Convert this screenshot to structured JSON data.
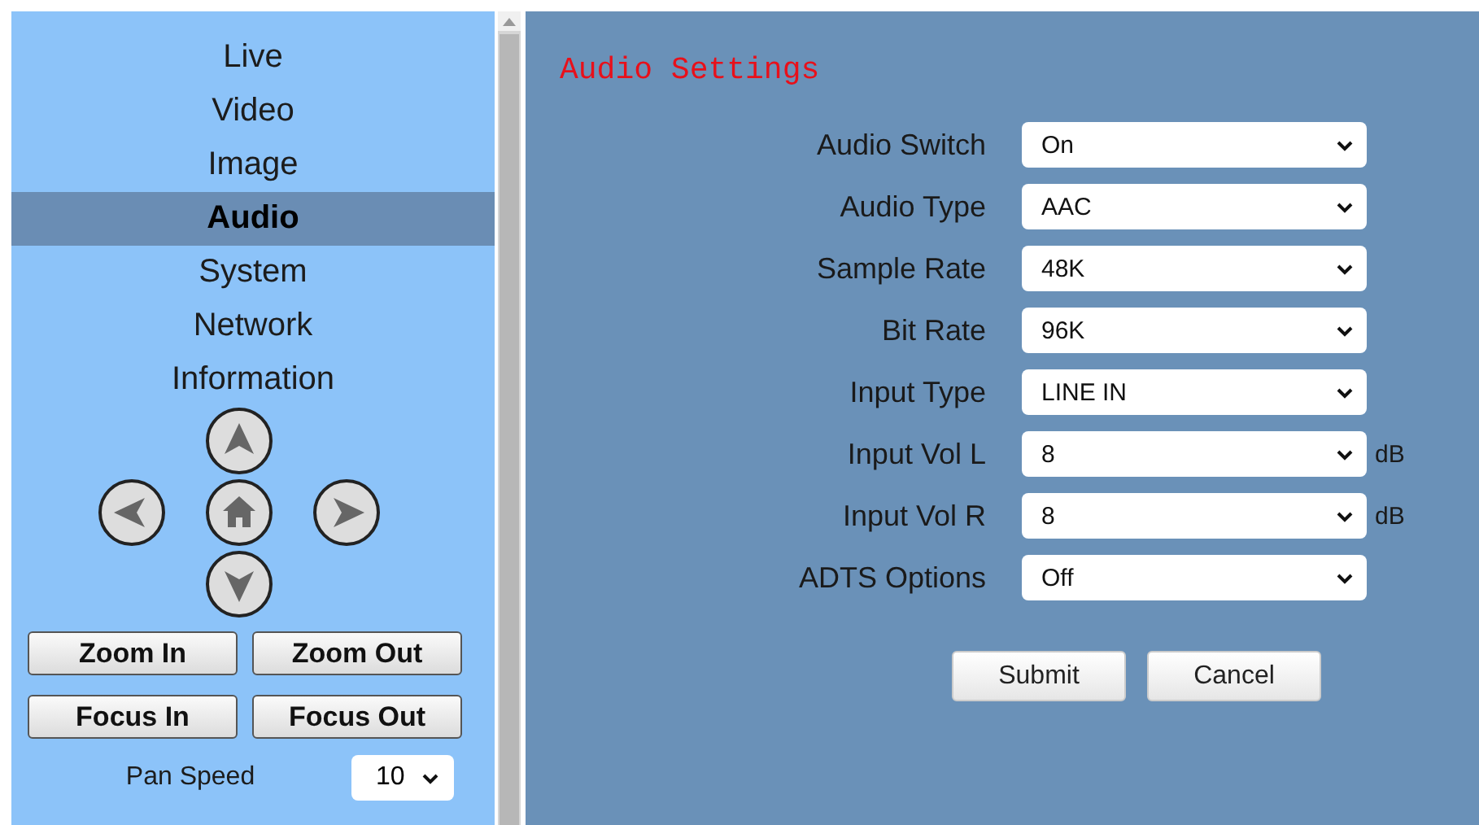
{
  "sidebar": {
    "items": [
      {
        "label": "Live",
        "selected": false
      },
      {
        "label": "Video",
        "selected": false
      },
      {
        "label": "Image",
        "selected": false
      },
      {
        "label": "Audio",
        "selected": true
      },
      {
        "label": "System",
        "selected": false
      },
      {
        "label": "Network",
        "selected": false
      },
      {
        "label": "Information",
        "selected": false
      }
    ]
  },
  "ptz": {
    "buttons": [
      "Zoom In",
      "Zoom Out",
      "Focus In",
      "Focus Out"
    ],
    "pan_speed": {
      "label": "Pan Speed",
      "value": "10"
    }
  },
  "main": {
    "title": "Audio Settings",
    "fields": [
      {
        "label": "Audio Switch",
        "value": "On"
      },
      {
        "label": "Audio Type",
        "value": "AAC"
      },
      {
        "label": "Sample Rate",
        "value": "48K"
      },
      {
        "label": "Bit Rate",
        "value": "96K"
      },
      {
        "label": "Input Type",
        "value": "LINE IN"
      },
      {
        "label": "Input Vol L",
        "value": "8",
        "unit": "dB"
      },
      {
        "label": "Input Vol R",
        "value": "8",
        "unit": "dB"
      },
      {
        "label": "ADTS Options",
        "value": "Off"
      }
    ],
    "buttons": [
      "Submit",
      "Cancel"
    ]
  }
}
